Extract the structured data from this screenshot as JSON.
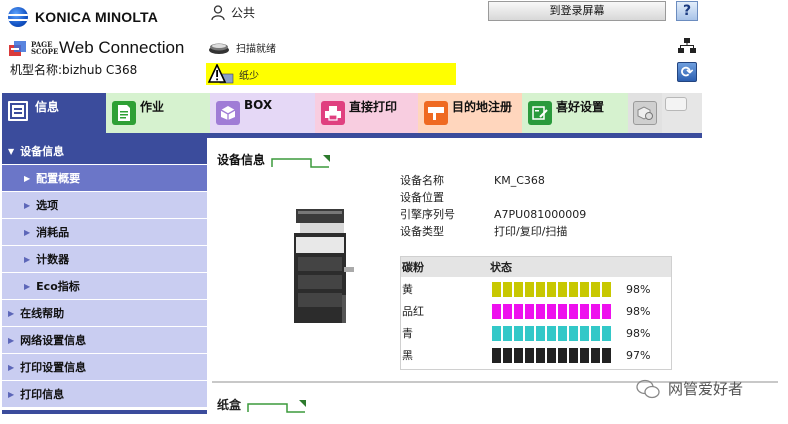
{
  "brand": {
    "maker": "KONICA MINOLTA",
    "product_small": "PAGE SCOPE",
    "product": "Web Connection"
  },
  "device": {
    "model_line": "机型名称:bizhub C368"
  },
  "user": {
    "name": "公共",
    "icon": "user-icon"
  },
  "header": {
    "login_button": "到登录屏幕",
    "help_button": "?",
    "refresh_icon": "refresh-icon",
    "sitemap_icon": "sitemap-icon"
  },
  "status": {
    "ready_text": "扫描就绪",
    "alert_text": "纸少",
    "alert_color": "#ffff00"
  },
  "tabs": [
    {
      "label": "信息",
      "icon": "info-icon",
      "color": "#3b4c9c"
    },
    {
      "label": "作业",
      "icon": "job-icon",
      "color": "#d6f2cf"
    },
    {
      "label": "BOX",
      "icon": "box-icon",
      "color": "#e5d8f6"
    },
    {
      "label": "直接打印",
      "icon": "direct-print-icon",
      "color": "#f8cde0"
    },
    {
      "label": "目的地注册",
      "icon": "destination-icon",
      "color": "#ffd6bd"
    },
    {
      "label": "喜好设置",
      "icon": "favorite-icon",
      "color": "#d6f2cf"
    }
  ],
  "sidebar": {
    "items": [
      {
        "label": "设备信息",
        "state": "open"
      },
      {
        "label": "配置概要",
        "state": "active"
      },
      {
        "label": "选项",
        "state": "sub"
      },
      {
        "label": "消耗品",
        "state": "sub"
      },
      {
        "label": "计数器",
        "state": "sub"
      },
      {
        "label": "Eco指标",
        "state": "sub"
      },
      {
        "label": "在线帮助",
        "state": "top"
      },
      {
        "label": "网络设置信息",
        "state": "top"
      },
      {
        "label": "打印设置信息",
        "state": "top"
      },
      {
        "label": "打印信息",
        "state": "top"
      }
    ]
  },
  "main": {
    "section_title": "设备信息",
    "info": [
      {
        "key": "设备名称",
        "value": "KM_C368"
      },
      {
        "key": "设备位置",
        "value": ""
      },
      {
        "key": "引擎序列号",
        "value": "A7PU081000009"
      },
      {
        "key": "设备类型",
        "value": "打印/复印/扫描"
      }
    ],
    "toner_header": {
      "col1": "碳粉",
      "col2": "状态"
    },
    "toner": [
      {
        "name": "黄",
        "percent_text": "98%",
        "level": 0.98,
        "color": "#c8c800"
      },
      {
        "name": "品红",
        "percent_text": "98%",
        "level": 0.98,
        "color": "#ee10ee"
      },
      {
        "name": "青",
        "percent_text": "98%",
        "level": 0.98,
        "color": "#33c8c8"
      },
      {
        "name": "黑",
        "percent_text": "97%",
        "level": 0.97,
        "color": "#222222"
      }
    ],
    "tray_title": "纸盒"
  },
  "watermark": {
    "text": "网管爱好者",
    "icon": "wechat-icon"
  }
}
